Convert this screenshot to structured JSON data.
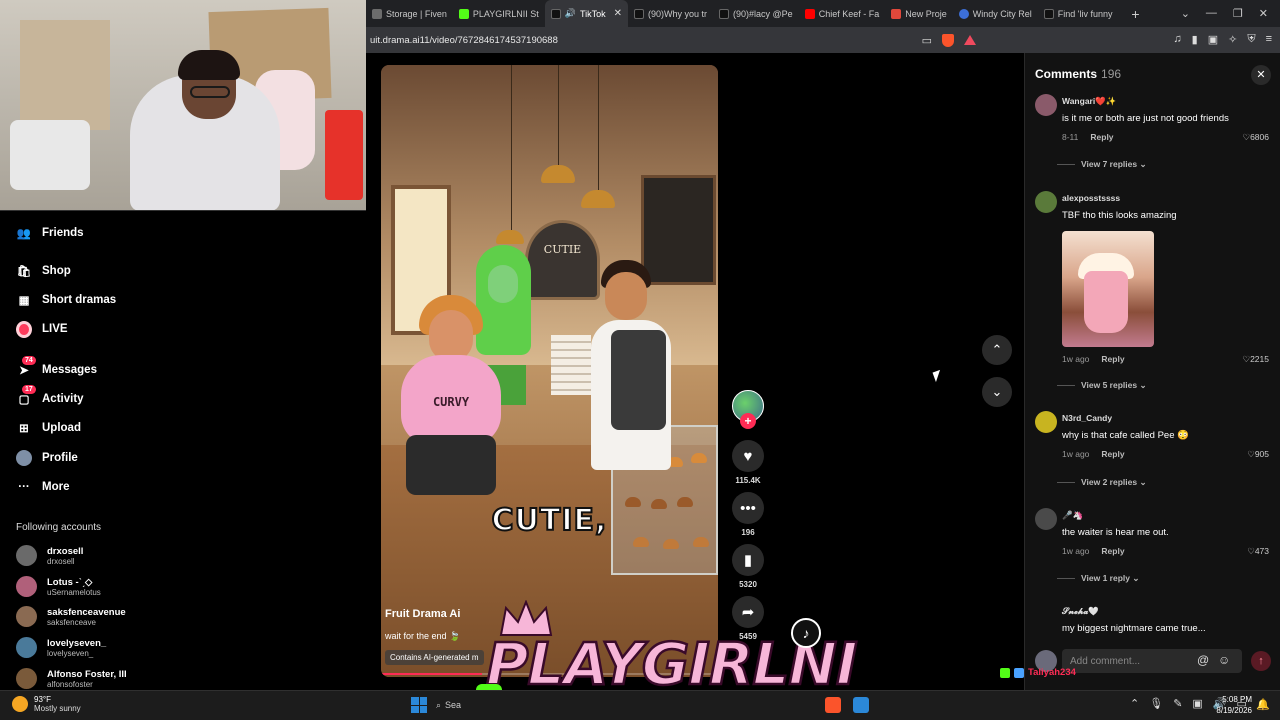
{
  "browser": {
    "tabs": [
      {
        "label": "Storage | Fiven",
        "color": "#6c6c6c",
        "active": false
      },
      {
        "label": "PLAYGIRLNII St",
        "color": "#53fc18",
        "active": false
      },
      {
        "label": "TikTok",
        "color": "#111111",
        "active": true
      },
      {
        "label": "(90)Why you tr",
        "color": "#111111",
        "active": false
      },
      {
        "label": "(90)#lacy @Pe",
        "color": "#111111",
        "active": false
      },
      {
        "label": "Chief Keef - Fa",
        "color": "#ff0000",
        "active": false
      },
      {
        "label": "New Proje",
        "color": "#e0483b",
        "active": false
      },
      {
        "label": "Windy City Rel",
        "color": "#3c6fd8",
        "active": false
      },
      {
        "label": "Find 'liv funny",
        "color": "#111111",
        "active": false
      }
    ],
    "url": "uit.drama.ai11/video/7672846174537190688"
  },
  "sidebar": {
    "items": [
      {
        "label": "Friends",
        "icon": "friends-icon"
      },
      {
        "label": "Shop",
        "icon": "shop-icon"
      },
      {
        "label": "Short dramas",
        "icon": "short-dramas-icon"
      },
      {
        "label": "LIVE",
        "icon": "live-icon"
      },
      {
        "label": "Messages",
        "icon": "messages-icon",
        "badge": "74"
      },
      {
        "label": "Activity",
        "icon": "activity-icon",
        "badge": "17"
      },
      {
        "label": "Upload",
        "icon": "upload-icon"
      },
      {
        "label": "Profile",
        "icon": "profile-icon"
      },
      {
        "label": "More",
        "icon": "more-icon"
      }
    ],
    "following_label": "Following accounts",
    "following": [
      {
        "name": "drxosell",
        "handle": "drxosell",
        "color": "#6a6a6a"
      },
      {
        "name": "Lotus -ˋˏ◇",
        "handle": "uSernamelotus",
        "color": "#b0607a"
      },
      {
        "name": "saksfenceavenue",
        "handle": "saksfenceave",
        "color": "#8a6a52"
      },
      {
        "name": "lovelyseven_",
        "handle": "lovelyseven_",
        "color": "#4a7a9a"
      },
      {
        "name": "Alfonso Foster, III",
        "handle": "alfonsofoster",
        "color": "#7a5a3a"
      }
    ]
  },
  "video": {
    "caption": "CUTIE,",
    "author": "Fruit Drama Ai",
    "description": "wait for the end 🍃",
    "ai_label": "Contains AI-generated m",
    "sign_text": "CUTIE",
    "shirt_text": "CURVY",
    "progress": 0.3
  },
  "actions": {
    "likes": "115.4K",
    "comments": "196",
    "saves": "5320",
    "shares": "5459"
  },
  "comments": {
    "title": "Comments",
    "count": "196",
    "items": [
      {
        "user": "Wangari❤️✨",
        "text": "is it me or both are just not good friends",
        "time": "8-11",
        "reply": "Reply",
        "likes": "6806",
        "view_replies": "View 7 replies",
        "avatar_color": "#8a5a6a"
      },
      {
        "user": "alexposstssss",
        "text": "TBF tho this looks amazing",
        "time": "1w ago",
        "reply": "Reply",
        "likes": "2215",
        "view_replies": "View 5 replies",
        "avatar_color": "#5a7a3a"
      },
      {
        "user": "N3rd_Candy",
        "text": "why is that cafe called Pee 😳",
        "time": "1w ago",
        "reply": "Reply",
        "likes": "905",
        "view_replies": "View 2 replies",
        "avatar_color": "#c8b420"
      },
      {
        "user": "🎤🦄",
        "text": "the waiter is hear me out.",
        "time": "1w ago",
        "reply": "Reply",
        "likes": "473",
        "view_replies": "View 1 reply",
        "avatar_color": "#4a4a4a"
      },
      {
        "user": "𝓢𝓷𝓮𝓱𝓪🤍",
        "text": "my biggest nightmare came true...",
        "time": "",
        "reply": "",
        "likes": "",
        "view_replies": "",
        "avatar_color": "#121212"
      }
    ],
    "input_placeholder": "Add comment...",
    "my_avatar_color": "#6a6a7a"
  },
  "overlay": {
    "logo_text": "PLAYGIRLNI",
    "stream_user": "Taliyah234"
  },
  "taskbar": {
    "temp": "93°F",
    "weather": "Mostly sunny",
    "search": "Sea",
    "time": "5:08 PM",
    "date": "8/19/2026"
  }
}
